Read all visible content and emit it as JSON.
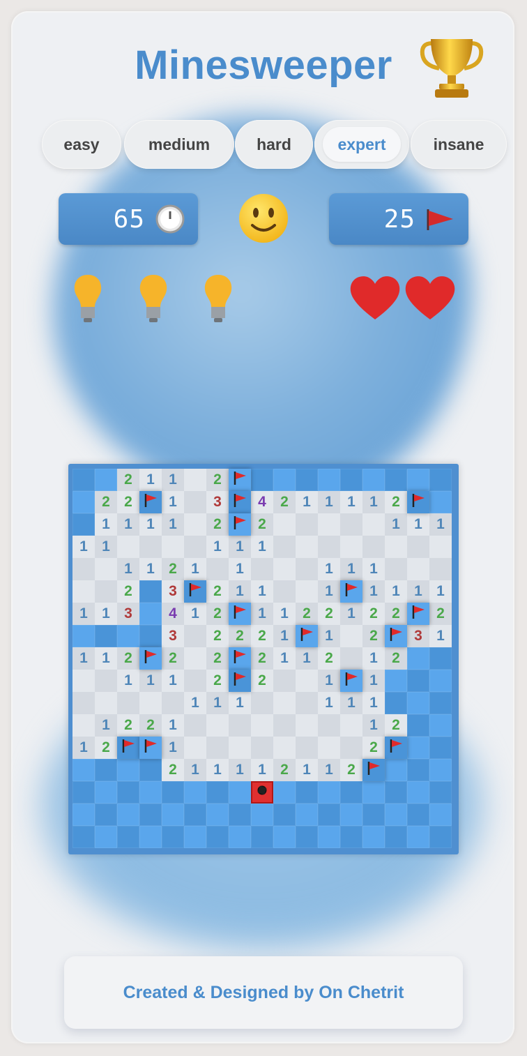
{
  "app": {
    "title": "Minesweeper"
  },
  "levels": [
    {
      "label": "easy",
      "active": false
    },
    {
      "label": "medium",
      "active": false
    },
    {
      "label": "hard",
      "active": false
    },
    {
      "label": "expert",
      "active": true
    },
    {
      "label": "insane",
      "active": false
    }
  ],
  "timer": {
    "value": "65",
    "icon": "stopwatch-icon"
  },
  "mines_counter": {
    "value": "25",
    "icon": "flag-icon"
  },
  "face": {
    "icon": "smiley-face-icon"
  },
  "hints": {
    "count": 3,
    "icon": "lightbulb-icon"
  },
  "lives": {
    "count": 2,
    "icon": "heart-icon"
  },
  "board": {
    "size": 17,
    "legend": "H = hidden, F = flag, X = mine, . = revealed empty, digit = adjacent count",
    "rows": [
      "HH211.2FHHHHHHHHH",
      "H22F1.3F4211112FH",
      "H1111.2F2.....111",
      "11....111........",
      "..1121.1...111...",
      "..2H3F211..1F1111",
      "113H412F1122122F2.",
      "HHHH3.2221F1.2F31",
      "112F2.2F2112.12HHH",
      "..111.2F2..1F1HHH",
      ".....111...111HHH",
      ".1221........12HHH",
      "12FF1........2FHHH",
      "HHHH211112112FHHH",
      "HHHHHHHHXHHHHHHHH",
      "HHHHHHHHHHHHHHHHH",
      "HHHHHHHHHHHHHHHHH"
    ]
  },
  "colors": {
    "accent": "#4a8ccc",
    "hidden_cell": "#5aa6ec",
    "revealed_cell": "#e3e7ec",
    "mine_cell": "#e03030"
  },
  "footer": {
    "credit": "Created & Designed by On Chetrit"
  }
}
